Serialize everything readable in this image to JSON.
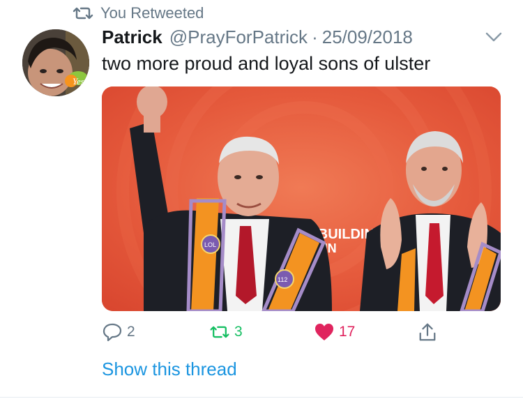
{
  "retweet_context": {
    "label": "You Retweeted",
    "icon": "retweet-icon"
  },
  "tweet": {
    "author_name": "Patrick",
    "author_handle": "@PrayForPatrick",
    "separator": "·",
    "date": "25/09/2018",
    "text": "two more proud and loyal sons of ulster",
    "media": {
      "banner_line1": "REBUILDING",
      "banner_line2": "TAIN",
      "sash_badge_left": "LOL",
      "sash_badge_number": "112",
      "avatar_badge": "Yes"
    }
  },
  "actions": {
    "reply_count": "2",
    "retweet_count": "3",
    "like_count": "17"
  },
  "show_thread": "Show this thread",
  "colors": {
    "retweet_green": "#17bf63",
    "like_red": "#e0245e",
    "link_blue": "#1b95e0",
    "muted_gray": "#657786",
    "media_background": "#e4573c"
  }
}
